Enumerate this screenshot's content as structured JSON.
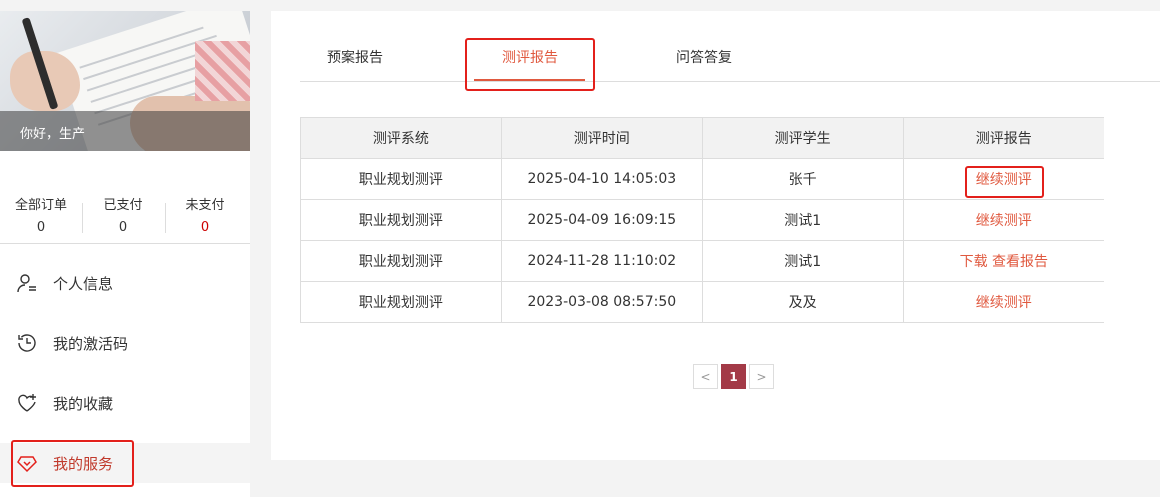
{
  "user": {
    "greeting": "你好，生产"
  },
  "stats": [
    {
      "label": "全部订单",
      "value": "0"
    },
    {
      "label": "已支付",
      "value": "0"
    },
    {
      "label": "未支付",
      "value": "0"
    }
  ],
  "menu": [
    {
      "label": "个人信息",
      "icon": "user-list-icon"
    },
    {
      "label": "我的激活码",
      "icon": "history-clock-icon"
    },
    {
      "label": "我的收藏",
      "icon": "heart-plus-icon"
    },
    {
      "label": "我的服务",
      "icon": "diamond-icon",
      "active": true
    }
  ],
  "tabs": [
    {
      "label": "预案报告"
    },
    {
      "label": "测评报告",
      "active": true
    },
    {
      "label": "问答答复"
    }
  ],
  "table": {
    "headers": [
      "测评系统",
      "测评时间",
      "测评学生",
      "测评报告"
    ],
    "rows": [
      {
        "system": "职业规划测评",
        "time": "2025-04-10 14:05:03",
        "student": "张千",
        "action": "继续测评"
      },
      {
        "system": "职业规划测评",
        "time": "2025-04-09 16:09:15",
        "student": "测试1",
        "action": "继续测评"
      },
      {
        "system": "职业规划测评",
        "time": "2024-11-28 11:10:02",
        "student": "测试1",
        "action_download": "下载",
        "action_view": "查看报告"
      },
      {
        "system": "职业规划测评",
        "time": "2023-03-08 08:57:50",
        "student": "及及",
        "action": "继续测评"
      }
    ]
  },
  "pagination": {
    "prev": "<",
    "current": "1",
    "next": ">"
  },
  "colors": {
    "accent": "#e0593f",
    "highlight_box": "#e3201b",
    "pager_active": "#a33a47",
    "unpaid_value": "#cc0000"
  }
}
